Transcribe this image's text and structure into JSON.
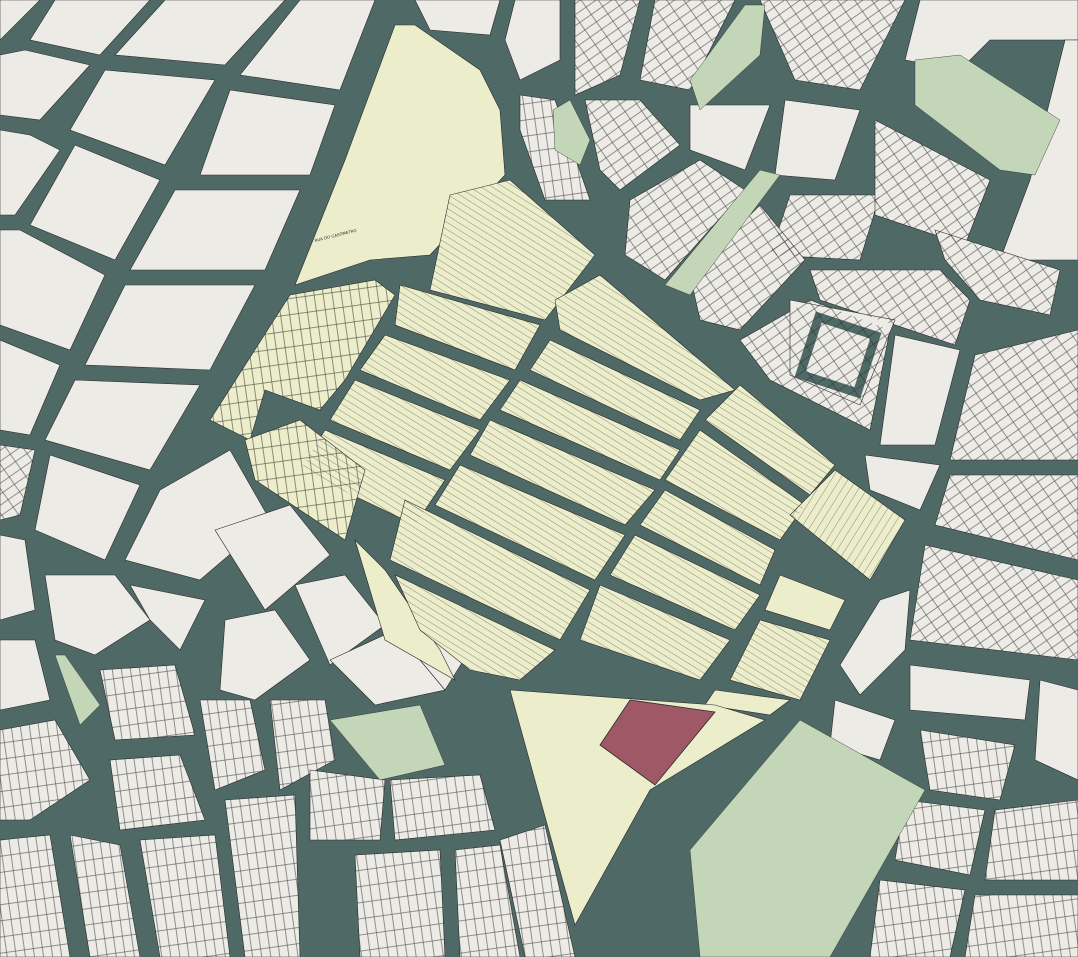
{
  "map": {
    "colors": {
      "street": "#4f6a66",
      "block": "#edebe6",
      "district": "#eceecb",
      "park": "#c4d6b8",
      "landmark": "#9e5866",
      "lot_line": "#2a2a2a"
    },
    "road_label": "RUA DO GASÔMETRO",
    "layers": [
      "street-network",
      "city-blocks",
      "highlighted-district",
      "green-spaces",
      "landmark-parcel"
    ]
  }
}
